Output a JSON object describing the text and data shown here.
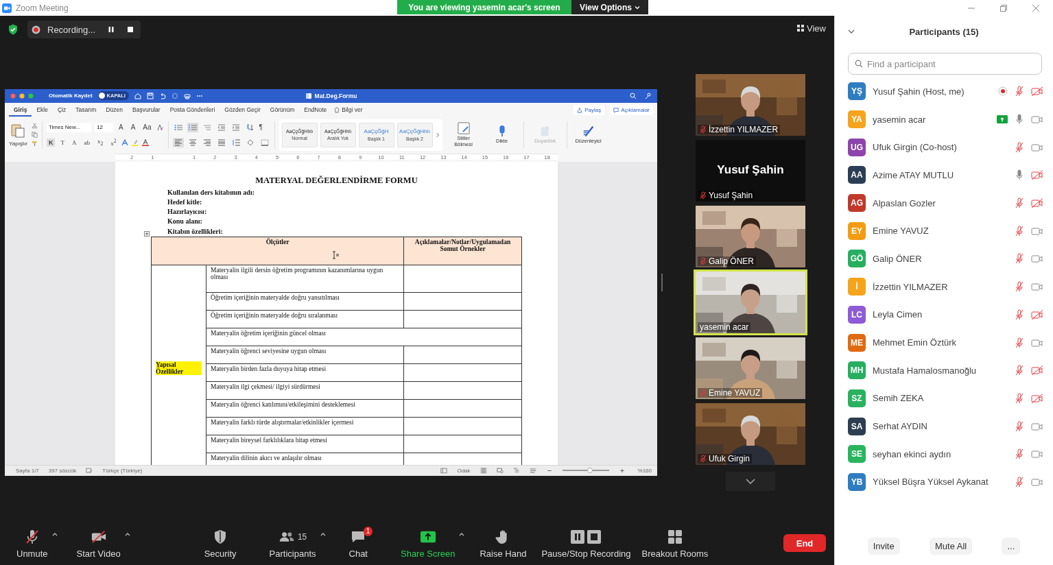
{
  "window": {
    "title": "Zoom Meeting"
  },
  "banner": {
    "text": "You are viewing yasemin acar's screen",
    "options": "View Options"
  },
  "recording": {
    "label": "Recording..."
  },
  "view_button": "View",
  "shared_window": {
    "autosave_label": "Otomatik Kaydet",
    "autosave_state": "KAPALI",
    "autosave_on": false,
    "document_title": "Mat.Deg.Formu",
    "tabs": [
      {
        "label": "Giriş",
        "selected": true
      },
      {
        "label": "Ekle",
        "selected": false
      },
      {
        "label": "Çiz",
        "selected": false
      },
      {
        "label": "Tasarım",
        "selected": false
      },
      {
        "label": "Düzen",
        "selected": false
      },
      {
        "label": "Başvurular",
        "selected": false
      },
      {
        "label": "Posta Gönderileri",
        "selected": false
      },
      {
        "label": "Gözden Geçir",
        "selected": false
      },
      {
        "label": "Görünüm",
        "selected": false
      },
      {
        "label": "EndNote",
        "selected": false
      }
    ],
    "tell_me": "Bilgi ver",
    "share": "Paylaş",
    "comments": "Açıklamalar",
    "paste_label": "Yapıştır",
    "font": "Times New...",
    "font_size": "12",
    "font_buttons_top": [
      "A",
      "A",
      "Aa"
    ],
    "font_buttons_bottom": [
      "K",
      "T",
      "A",
      "ab",
      "x$_{2}$",
      "x$^{2}$"
    ],
    "pilcrow": "¶",
    "styles": [
      {
        "sample": "AaÇçĞğHhIı",
        "name": "Normal",
        "kind": "body"
      },
      {
        "sample": "AaÇçĞğHhIı",
        "name": "Aralık Yok",
        "kind": "body"
      },
      {
        "sample": "AaÇçĞğH",
        "name": "Başlık 1",
        "kind": "heading"
      },
      {
        "sample": "AaÇçĞğHhIı",
        "name": "Başlık 2",
        "kind": "heading"
      }
    ],
    "big_buttons": [
      {
        "label": "Stiller Bölmesi",
        "kind": "pane",
        "disabled": false
      },
      {
        "label": "Dikte",
        "kind": "mic",
        "disabled": false
      },
      {
        "label": "Duyarlılık",
        "kind": "sensitivity",
        "disabled": true
      },
      {
        "label": "Düzenleyici",
        "kind": "editor",
        "disabled": false
      }
    ],
    "ruler": [
      "2",
      "1",
      "1",
      "2",
      "3",
      "4",
      "5",
      "6",
      "7",
      "8",
      "9",
      "10",
      "11",
      "12",
      "13",
      "14",
      "15",
      "16",
      "17",
      "18"
    ],
    "document": {
      "title": "MATERYAL DEĞERLENDİRME FORMU",
      "fields": [
        "Kullanılan ders kitabının adı:",
        "Hedef kitle:",
        "Hazırlayıcısı:",
        "Konu alanı:",
        "Kitabın özellikleri:"
      ],
      "header": [
        "Ölçütler",
        "Açıklamalar/Notlar/Uygulamadan Somut Örnekler"
      ],
      "group": "Yapısal Özellikler",
      "rows": [
        {
          "text": "Materyalin ilgili dersin öğretim programının kazanımlarına uygun olması",
          "merged": false
        },
        {
          "text": "Öğretim içeriğinin materyalde doğru yansıtılması",
          "merged": false
        },
        {
          "text": "Öğretim içeriğinin materyalde doğru sıralanması",
          "merged": false
        },
        {
          "text": "Materyalin öğretim içeriğinin güncel olması",
          "merged": true
        },
        {
          "text": "Materyalin öğrenci seviyesine uygun olması",
          "merged": false
        },
        {
          "text": "Materyalin birden fazla duyuya hitap etmesi",
          "merged": false
        },
        {
          "text": "Materyalin ilgi çekmesi/ ilgiyi sürdürmesi",
          "merged": false
        },
        {
          "text": "Materyalin öğrenci katılımını/etkileşimini desteklemesi",
          "merged": false
        },
        {
          "text": "Materyalin farklı türde alıştırmalar/etkinlikler içermesi",
          "merged": false
        },
        {
          "text": "Materyalin bireysel farklılıklara hitap etmesi",
          "merged": false
        },
        {
          "text": "Materyalin dilinin akıcı ve anlaşılır olması",
          "merged": false
        }
      ]
    },
    "status": {
      "page": "Sayfa 1/7",
      "words": "397 sözcük",
      "language": "Türkçe (Türkiye)",
      "focus": "Odak",
      "zoom": "%160",
      "zoom_slider": {
        "level": 0.6
      }
    }
  },
  "tiles": [
    {
      "name": "İzzettin YILMAZER",
      "kind": "video",
      "muted": true,
      "active": false
    },
    {
      "name": "Yusuf Şahin",
      "kind": "name",
      "display_name": "Yusuf Şahin",
      "muted": true,
      "active": false
    },
    {
      "name": "Galip ÖNER",
      "kind": "video",
      "muted": true,
      "active": false
    },
    {
      "name": "yasemin acar",
      "kind": "video",
      "muted": false,
      "active": true
    },
    {
      "name": "Emine YAVUZ",
      "kind": "video",
      "muted": true,
      "active": false
    },
    {
      "name": "Ufuk Girgin",
      "kind": "video",
      "muted": true,
      "active": false
    }
  ],
  "toolbar": [
    {
      "label": "Unmute",
      "kind": "mic",
      "off": true,
      "caret": true
    },
    {
      "label": "Start Video",
      "kind": "video",
      "off": true,
      "caret": true
    },
    {
      "label": "Security",
      "kind": "security",
      "caret": false
    },
    {
      "label": "Participants",
      "kind": "participants",
      "count": "15",
      "caret": true
    },
    {
      "label": "Chat",
      "kind": "chat",
      "badge": "1",
      "caret": false
    },
    {
      "label": "Share Screen",
      "kind": "share",
      "caret": true
    },
    {
      "label": "Raise Hand",
      "kind": "hand",
      "caret": false
    },
    {
      "label": "Pause/Stop Recording",
      "kind": "recording",
      "caret": false
    },
    {
      "label": "Breakout Rooms",
      "kind": "rooms",
      "caret": false
    }
  ],
  "end_button": "End",
  "participants": {
    "title": "Participants (15)",
    "search_placeholder": "Find a participant",
    "items": [
      {
        "initials": "YŞ",
        "name": "Yusuf Şahin (Host, me)",
        "color": "#2f7dc1",
        "muted": true,
        "video": false,
        "recording": true,
        "sharing": false
      },
      {
        "initials": "YA",
        "name": "yasemin acar",
        "color": "#f5a41c",
        "muted": false,
        "video": true,
        "recording": false,
        "sharing": true
      },
      {
        "initials": "UG",
        "name": "Ufuk Girgin (Co-host)",
        "color": "#8e44ad",
        "muted": true,
        "video": true,
        "recording": false,
        "sharing": false
      },
      {
        "initials": "AA",
        "name": "Azime ATAY MUTLU",
        "color": "#2c3e56",
        "muted": false,
        "video": false,
        "recording": false,
        "sharing": false
      },
      {
        "initials": "AG",
        "name": "Alpaslan Gozler",
        "color": "#c0392b",
        "muted": true,
        "video": false,
        "recording": false,
        "sharing": false
      },
      {
        "initials": "EY",
        "name": "Emine YAVUZ",
        "color": "#f39c12",
        "muted": true,
        "video": true,
        "recording": false,
        "sharing": false
      },
      {
        "initials": "GÖ",
        "name": "Galip ÖNER",
        "color": "#27ae60",
        "muted": true,
        "video": true,
        "recording": false,
        "sharing": false
      },
      {
        "initials": "İ",
        "name": "İzzettin YILMAZER",
        "color": "#f5a41c",
        "muted": true,
        "video": true,
        "recording": false,
        "sharing": false
      },
      {
        "initials": "LC",
        "name": "Leyla Cimen",
        "color": "#8e5bd6",
        "muted": true,
        "video": false,
        "recording": false,
        "sharing": false
      },
      {
        "initials": "ME",
        "name": "Mehmet Emin Öztürk",
        "color": "#e06a12",
        "muted": true,
        "video": true,
        "recording": false,
        "sharing": false
      },
      {
        "initials": "MH",
        "name": "Mustafa Hamalosmanoğlu",
        "color": "#27ae60",
        "muted": true,
        "video": false,
        "recording": false,
        "sharing": false
      },
      {
        "initials": "SZ",
        "name": "Semih ZEKA",
        "color": "#2bb15f",
        "muted": true,
        "video": false,
        "recording": false,
        "sharing": false
      },
      {
        "initials": "SA",
        "name": "Serhat AYDIN",
        "color": "#2c3e50",
        "muted": true,
        "video": true,
        "recording": false,
        "sharing": false
      },
      {
        "initials": "SE",
        "name": "seyhan ekinci aydın",
        "color": "#29b45e",
        "muted": true,
        "video": true,
        "recording": false,
        "sharing": false
      },
      {
        "initials": "YB",
        "name": "Yüksel Büşra Yüksel Aykanat",
        "color": "#2f7dc1",
        "muted": true,
        "video": true,
        "recording": false,
        "sharing": false
      }
    ],
    "buttons": [
      "Invite",
      "Mute All",
      "..."
    ]
  }
}
